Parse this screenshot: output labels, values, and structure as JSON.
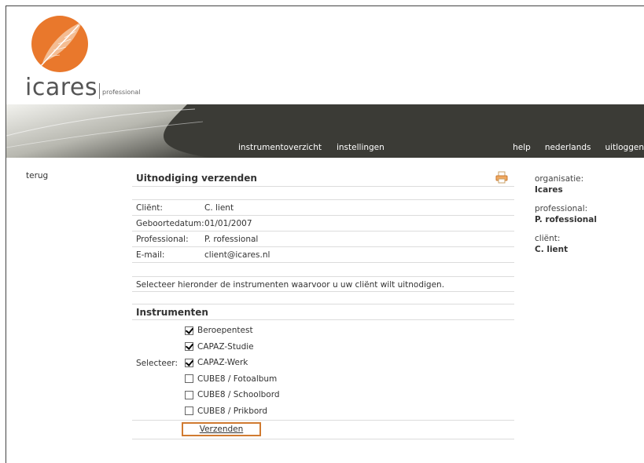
{
  "logo": {
    "word": "icares",
    "sub": "professional"
  },
  "nav": {
    "left": [
      "instrumentoverzicht",
      "instellingen"
    ],
    "right": [
      "help",
      "nederlands",
      "uitloggen"
    ]
  },
  "back_link": "terug",
  "panel": {
    "title": "Uitnodiging verzenden",
    "info": [
      {
        "label": "Cliënt:",
        "value": "C. lient"
      },
      {
        "label": "Geboortedatum:",
        "value": "01/01/2007"
      },
      {
        "label": "Professional:",
        "value": "P. rofessional"
      },
      {
        "label": "E-mail:",
        "value": "client@icares.nl"
      }
    ],
    "intro": "Selecteer hieronder de instrumenten waarvoor u uw cliënt wilt uitnodigen.",
    "instruments_heading": "Instrumenten",
    "select_label": "Selecteer:",
    "instruments": [
      {
        "label": "Beroepentest",
        "checked": true
      },
      {
        "label": "CAPAZ-Studie",
        "checked": true
      },
      {
        "label": "CAPAZ-Werk",
        "checked": true
      },
      {
        "label": "CUBE8 / Fotoalbum",
        "checked": false
      },
      {
        "label": "CUBE8 / Schoolbord",
        "checked": false
      },
      {
        "label": "CUBE8 / Prikbord",
        "checked": false
      }
    ],
    "submit": "Verzenden"
  },
  "side": [
    {
      "label": "organisatie:",
      "value": "Icares"
    },
    {
      "label": "professional:",
      "value": "P. rofessional"
    },
    {
      "label": "cliënt:",
      "value": "C. lient"
    }
  ],
  "colors": {
    "accent": "#e9782c",
    "header": "#3b3b36",
    "button_border": "#d07a30"
  }
}
